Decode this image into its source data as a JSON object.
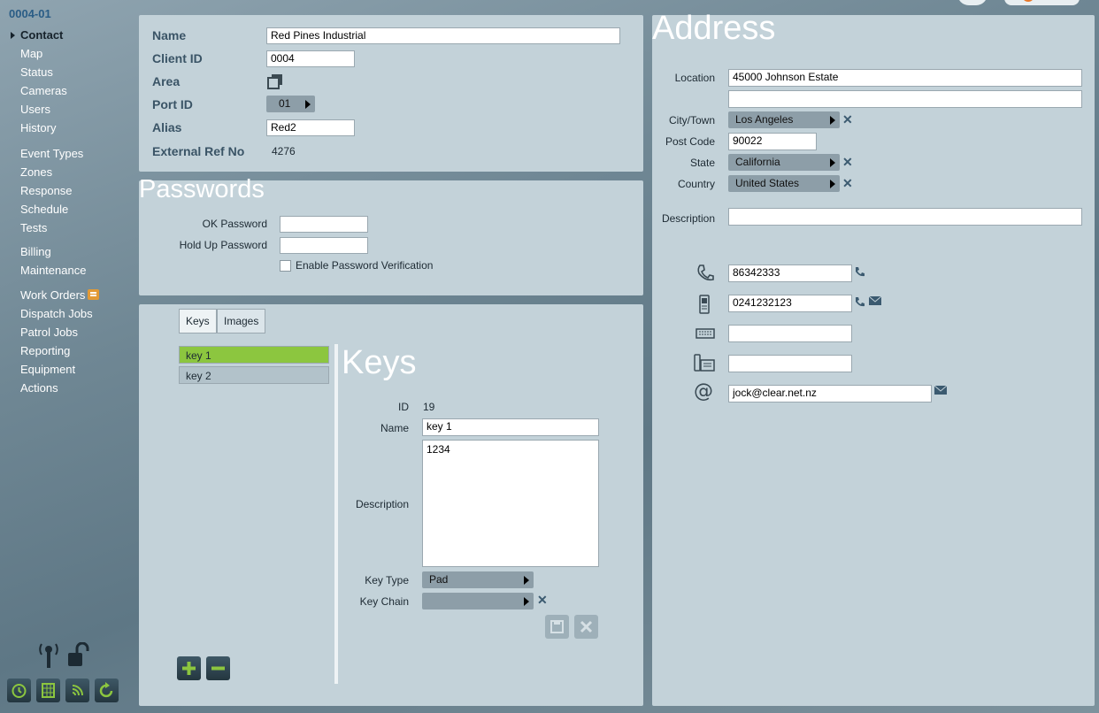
{
  "sidebar": {
    "account_id": "0004-01",
    "items": [
      {
        "label": "Contact",
        "active": true
      },
      {
        "label": "Map"
      },
      {
        "label": "Status"
      },
      {
        "label": "Cameras"
      },
      {
        "label": "Users"
      },
      {
        "label": "History"
      },
      {
        "label": "Event Types"
      },
      {
        "label": "Zones"
      },
      {
        "label": "Response"
      },
      {
        "label": "Schedule"
      },
      {
        "label": "Tests"
      },
      {
        "label": "Billing"
      },
      {
        "label": "Maintenance"
      },
      {
        "label": "Work Orders"
      },
      {
        "label": "Dispatch Jobs"
      },
      {
        "label": "Patrol Jobs"
      },
      {
        "label": "Reporting"
      },
      {
        "label": "Equipment"
      },
      {
        "label": "Actions"
      }
    ]
  },
  "contact": {
    "name_label": "Name",
    "name_value": "Red Pines Industrial",
    "client_id_label": "Client ID",
    "client_id_value": "0004",
    "area_label": "Area",
    "port_id_label": "Port ID",
    "port_id_value": "01",
    "alias_label": "Alias",
    "alias_value": "Red2",
    "ext_ref_label": "External Ref No",
    "ext_ref_value": "4276"
  },
  "passwords": {
    "title": "Passwords",
    "ok_label": "OK Password",
    "ok_value": "",
    "holdup_label": "Hold Up Password",
    "holdup_value": "",
    "verify_label": "Enable Password Verification"
  },
  "keys_panel": {
    "tabs": [
      "Keys",
      "Images"
    ],
    "list": [
      "key 1",
      "key 2"
    ],
    "title": "Keys",
    "id_label": "ID",
    "id_value": "19",
    "name_label": "Name",
    "name_value": "key 1",
    "desc_label": "Description",
    "desc_value": "1234",
    "key_type_label": "Key Type",
    "key_type_value": "Pad",
    "key_chain_label": "Key Chain",
    "key_chain_value": ""
  },
  "address": {
    "title": "Address",
    "location_label": "Location",
    "location_value": "45000 Johnson Estate",
    "location2_value": "",
    "city_label": "City/Town",
    "city_value": "Los Angeles",
    "postcode_label": "Post Code",
    "postcode_value": "90022",
    "state_label": "State",
    "state_value": "California",
    "country_label": "Country",
    "country_value": "United States",
    "description_label": "Description",
    "description_value": "",
    "phone_value": "86342333",
    "mobile_value": "0241232123",
    "fax_value": "",
    "other_phone_value": "",
    "email_value": "jock@clear.net.nz"
  },
  "colors": {
    "panel": "#c3d2d9",
    "accent_green": "#8cc63f",
    "label_blue": "#3a5466",
    "account_blue": "#2a5d86"
  }
}
